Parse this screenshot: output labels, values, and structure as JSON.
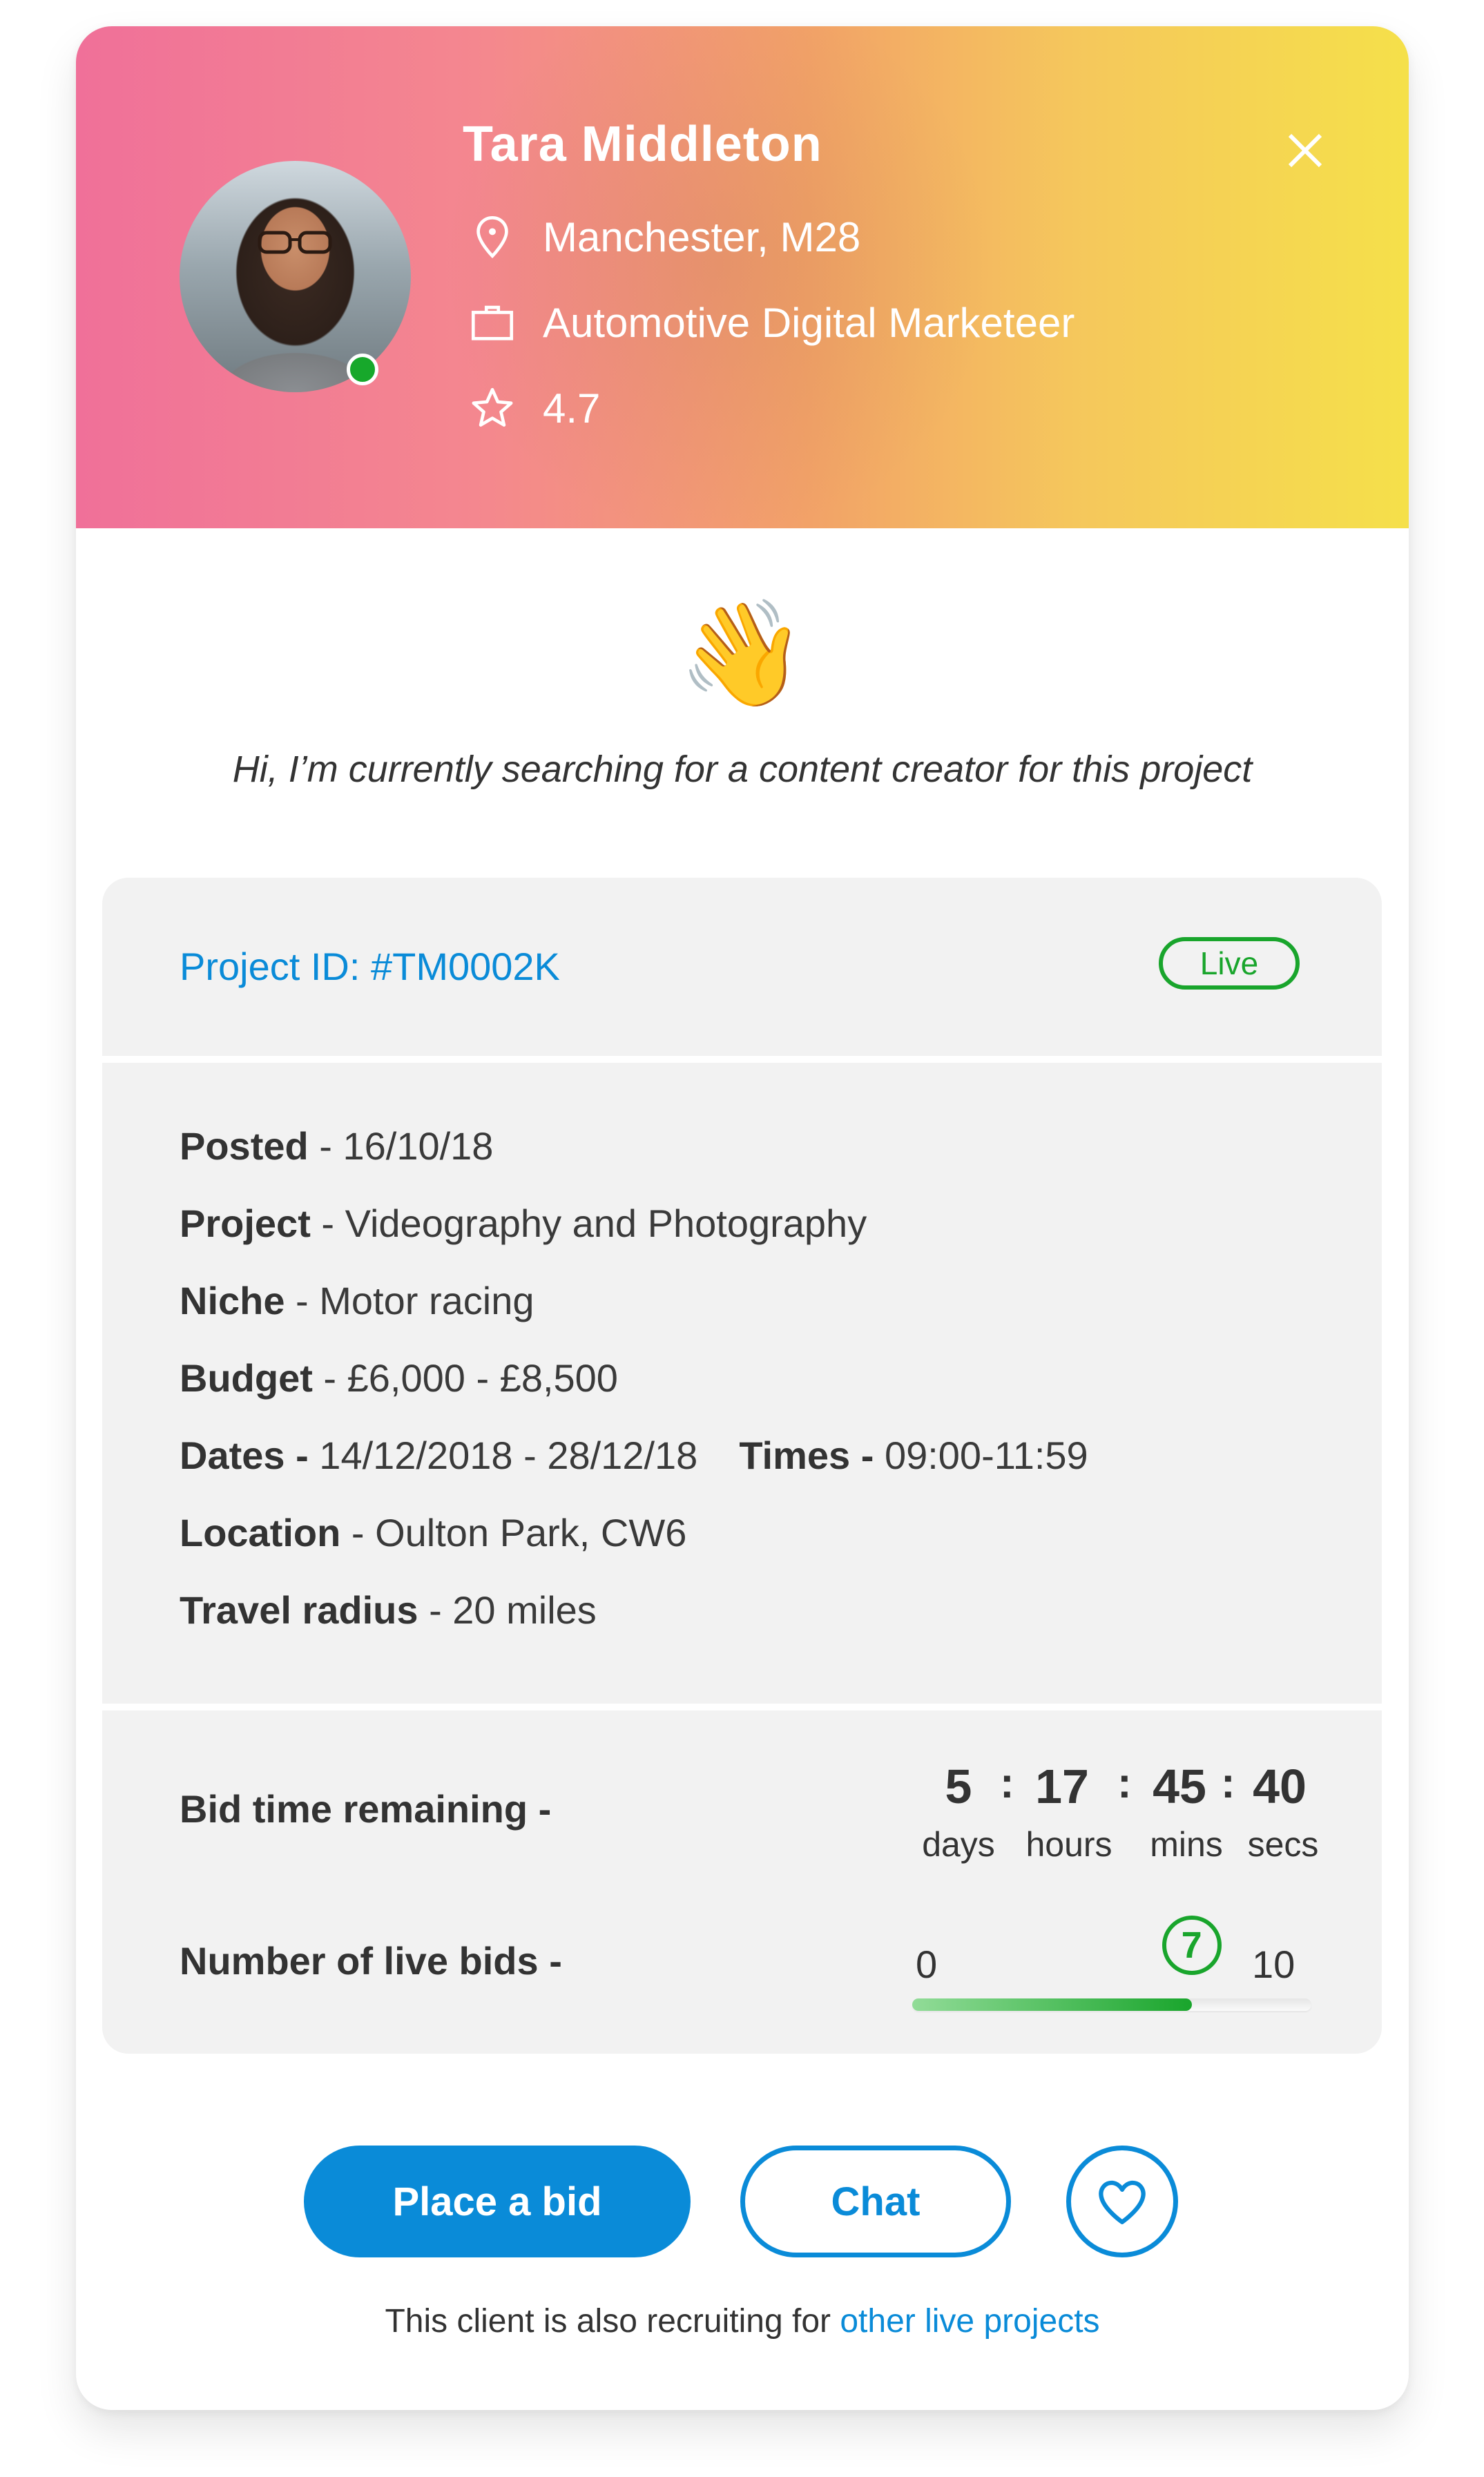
{
  "profile": {
    "name": "Tara Middleton",
    "location": "Manchester, M28",
    "occupation": "Automotive Digital Marketeer",
    "rating": "4.7",
    "status": "online",
    "icons": {
      "location": "map-pin-icon",
      "occupation": "briefcase-icon",
      "rating": "star-icon",
      "close": "close-icon"
    }
  },
  "greeting": {
    "emoji": "👋",
    "message": "Hi, I’m currently searching for a content creator for this project"
  },
  "project": {
    "id_label": "Project ID: #TM0002K",
    "status_badge": "Live",
    "details": [
      {
        "label": "Posted",
        "value": "16/10/18"
      },
      {
        "label": "Project",
        "value": "Videography and Photography"
      },
      {
        "label": "Niche",
        "value": "Motor racing"
      },
      {
        "label": "Budget",
        "value": "£6,000 - £8,500"
      },
      {
        "label": "Dates",
        "value": "14/12/2018 - 28/12/18"
      },
      {
        "label": "Location",
        "value": "Oulton Park, CW6"
      },
      {
        "label": "Travel radius",
        "value": "20 miles"
      }
    ],
    "times": {
      "label": "Times",
      "value": "09:00-11:59"
    },
    "separator": " - "
  },
  "bidding": {
    "time_remaining_label": "Bid time remaining -",
    "countdown": {
      "days": "5",
      "hours": "17",
      "mins": "45",
      "secs": "40",
      "units": {
        "days": "days",
        "hours": "hours",
        "mins": "mins",
        "secs": "secs"
      },
      "separator": ":"
    },
    "live_bids_label": "Number of live bids -",
    "live_bids": {
      "min": 0,
      "max": 10,
      "current": 7,
      "min_label": "0",
      "max_label": "10",
      "current_label": "7"
    }
  },
  "actions": {
    "place_bid": "Place a bid",
    "chat": "Chat",
    "favourite_icon": "heart-icon"
  },
  "footer": {
    "text": "This client is also recruiting for",
    "link": "other live projects"
  },
  "colors": {
    "primary": "#0a8bd8",
    "live_green": "#19a52c",
    "panel_bg": "#f2f2f2",
    "text": "#333333"
  }
}
